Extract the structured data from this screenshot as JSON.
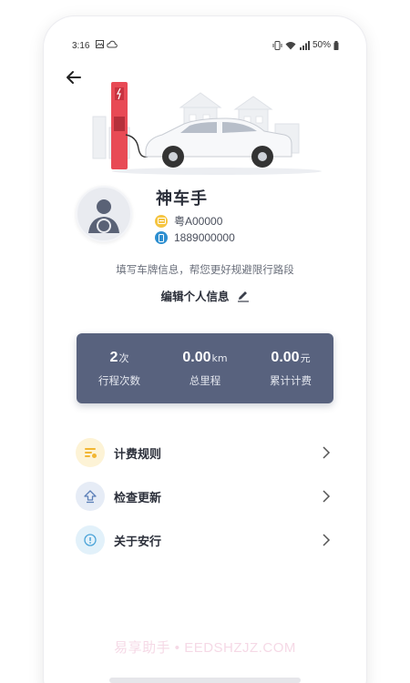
{
  "status_bar": {
    "time": "3:16",
    "battery_percent": "50%"
  },
  "profile": {
    "name": "神车手",
    "plate": "粤A00000",
    "phone": "1889000000",
    "plate_icon": "card-icon",
    "phone_icon": "mobile-icon"
  },
  "hint": "填写车牌信息，帮您更好规避限行路段",
  "edit": {
    "label": "编辑个人信息",
    "icon": "pencil-icon"
  },
  "stats": [
    {
      "value": "2",
      "unit": "次",
      "label": "行程次数"
    },
    {
      "value": "0.00",
      "unit": "km",
      "label": "总里程"
    },
    {
      "value": "0.00",
      "unit": "元",
      "label": "累计计费"
    }
  ],
  "menu": [
    {
      "label": "计费规则",
      "icon": "billing-rules-icon",
      "color": "#f5c542"
    },
    {
      "label": "检查更新",
      "icon": "update-icon",
      "color": "#5b7fb8"
    },
    {
      "label": "关于安行",
      "icon": "info-icon",
      "color": "#4aa3d8"
    }
  ],
  "watermark": "易享助手 • EEDSHZJZ.COM",
  "colors": {
    "card_bg": "#58627e",
    "plate_badge": "#f5c542",
    "phone_badge": "#2e8fd0",
    "charger": "#e84a55"
  }
}
